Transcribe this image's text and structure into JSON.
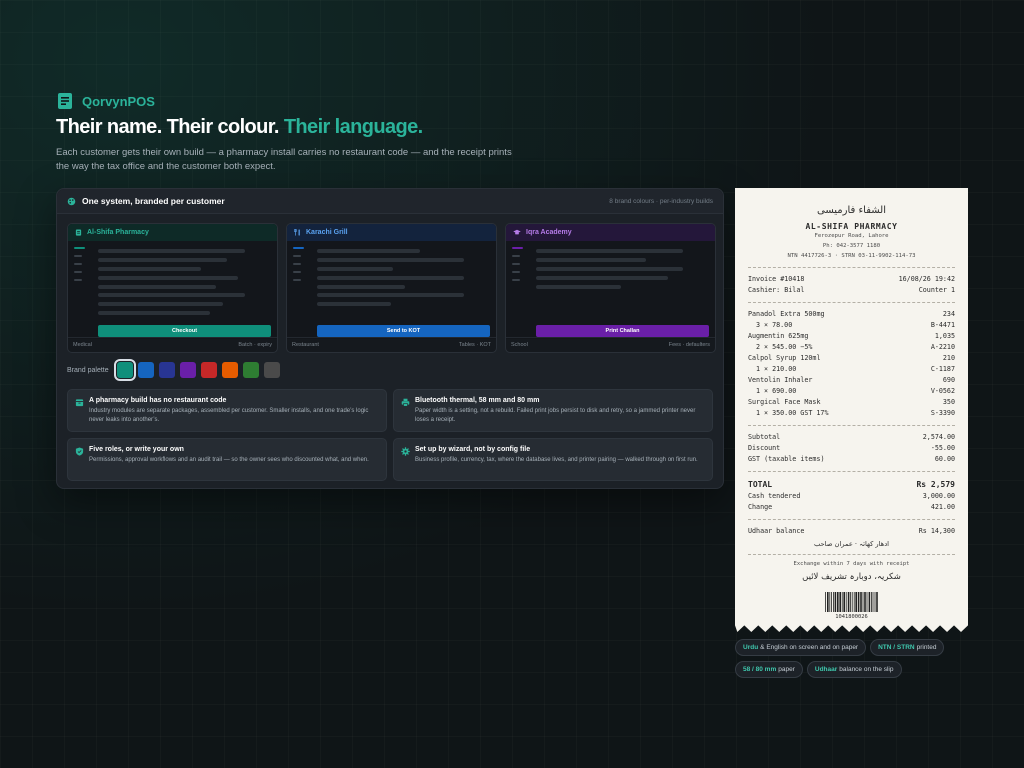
{
  "brand": {
    "name": "QorvynPOS",
    "icon": "receipt-icon",
    "accent": "#2bb39a"
  },
  "headline": {
    "lead": "Their name. Their colour.",
    "accent": "Their language."
  },
  "subhead": "Each customer gets their own build — a pharmacy install carries no restaurant code — and the receipt prints the way the tax office and the customer both expect.",
  "panel": {
    "title": "One system, branded per customer",
    "meta": "8 brand colours · per-industry builds",
    "builds": [
      {
        "name": "Al-Shifa Pharmacy",
        "cta": "Checkout",
        "industry": "Medical",
        "features": "Batch · expiry",
        "color": "#0f8f7b",
        "head_bg": "#0e2a27",
        "title_color": "#2bb39a",
        "icon": "pharmacy-icon"
      },
      {
        "name": "Karachi Grill",
        "cta": "Send to KOT",
        "industry": "Restaurant",
        "features": "Tables · KOT",
        "color": "#1565c0",
        "head_bg": "#13233d",
        "title_color": "#5aa2f0",
        "icon": "utensils-icon"
      },
      {
        "name": "Iqra Academy",
        "cta": "Print Challan",
        "industry": "School",
        "features": "Fees · defaulters",
        "color": "#6a1fa8",
        "head_bg": "#24173a",
        "title_color": "#b57be8",
        "icon": "graduation-cap-icon"
      }
    ],
    "palette_label": "Brand palette",
    "palette": [
      "#0f8f7b",
      "#1565c0",
      "#283593",
      "#6a1fa8",
      "#c62828",
      "#e65c00",
      "#2e7d32",
      "#4a4a4a"
    ],
    "features": [
      {
        "title": "A pharmacy build has no restaurant code",
        "body": "Industry modules are separate packages, assembled per customer. Smaller installs, and one trade’s logic never leaks into another’s.",
        "icon": "package-icon"
      },
      {
        "title": "Bluetooth thermal, 58 mm and 80 mm",
        "body": "Paper width is a setting, not a rebuild. Failed print jobs persist to disk and retry, so a jammed printer never loses a receipt.",
        "icon": "printer-icon"
      },
      {
        "title": "Five roles, or write your own",
        "body": "Permissions, approval workflows and an audit trail — so the owner sees who discounted what, and when.",
        "icon": "shield-icon"
      },
      {
        "title": "Set up by wizard, not by config file",
        "body": "Business profile, currency, tax, where the database lives, and printer pairing — walked through on first run.",
        "icon": "gear-icon"
      }
    ]
  },
  "receipt": {
    "urdu_name": "الشفاء فارمیسی",
    "name": "AL-SHIFA PHARMACY",
    "address": "Ferozepur Road, Lahore",
    "phone": "Ph: 042-3577 1180",
    "tax": "NTN 4417726-3  ·  STRN 03-11-9902-114-73",
    "invoice": "Invoice #10418",
    "datetime": "16/08/26 19:42",
    "cashier": "Cashier: Bilal",
    "counter": "Counter 1",
    "items": [
      {
        "name": "Panadol Extra 500mg",
        "amount": "234",
        "detail": "3 × 78.00",
        "code": "B-4471"
      },
      {
        "name": "Augmentin 625mg",
        "amount": "1,035",
        "detail": "2 × 545.00  −5%",
        "code": "A-2210"
      },
      {
        "name": "Calpol Syrup 120ml",
        "amount": "210",
        "detail": "1 × 210.00",
        "code": "C-1187"
      },
      {
        "name": "Ventolin Inhaler",
        "amount": "690",
        "detail": "1 × 690.00",
        "code": "V-0562"
      },
      {
        "name": "Surgical Face Mask",
        "amount": "350",
        "detail": "1 × 350.00  GST 17%",
        "code": "S-3390"
      }
    ],
    "subtotal_label": "Subtotal",
    "subtotal": "2,574.00",
    "discount_label": "Discount",
    "discount": "-55.00",
    "gst_label": "GST (taxable items)",
    "gst": "60.00",
    "total_label": "TOTAL",
    "total": "Rs 2,579",
    "tendered_label": "Cash tendered",
    "tendered": "3,000.00",
    "change_label": "Change",
    "change": "421.00",
    "udhaar_label": "Udhaar balance",
    "udhaar": "Rs 14,300",
    "udhaar_urdu": "ادھار کھاتہ · عمران صاحب",
    "exchange": "Exchange within 7 days with receipt",
    "thanks_urdu": "شکریہ، دوبارہ تشریف لائیں",
    "barcode_number": "1041800026"
  },
  "chips": [
    {
      "strong": "Urdu",
      "rest": " & English on screen and on paper"
    },
    {
      "strong": "NTN / STRN",
      "rest": " printed"
    },
    {
      "strong": "58 / 80 mm",
      "rest": " paper"
    },
    {
      "strong": "Udhaar",
      "rest": " balance on the slip"
    }
  ]
}
